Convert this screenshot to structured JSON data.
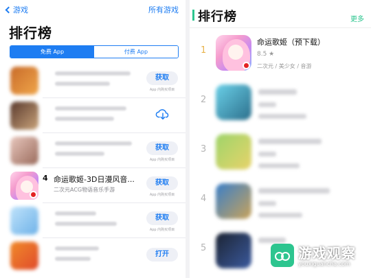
{
  "appstore": {
    "back_label": "游戏",
    "all_games_label": "所有游戏",
    "title": "排行榜",
    "segments": {
      "free": "免费 App",
      "paid": "付费 App"
    },
    "rows": [
      {
        "button": "获取",
        "iap": "App 内购买项目"
      },
      {
        "button": "",
        "iap": ""
      },
      {
        "button": "获取",
        "iap": "App 内购买项目"
      },
      {
        "rank": "4",
        "name": "命运歌姬-3D日漫风音...",
        "subtitle": "二次元ACG物语音乐手游",
        "button": "获取",
        "iap": "App 内购买项目"
      },
      {
        "button": "获取",
        "iap": "App 内购买项目"
      },
      {
        "button": "打开",
        "iap": ""
      }
    ]
  },
  "ranking": {
    "title": "排行榜",
    "more": "更多",
    "items": [
      {
        "rank": "1",
        "name": "命运歌姬（预下载）",
        "score": "8.5 ★",
        "tags": "二次元 / 美少女 / 音游"
      },
      {
        "rank": "2"
      },
      {
        "rank": "3"
      },
      {
        "rank": "4"
      },
      {
        "rank": "5"
      }
    ]
  },
  "watermark": {
    "name": "游戏观察",
    "url": "youxiguancha.com"
  },
  "colors": {
    "ios_blue": "#1e7df2",
    "accent_green": "#2dc58f",
    "gold_rank": "#e8b34a"
  }
}
